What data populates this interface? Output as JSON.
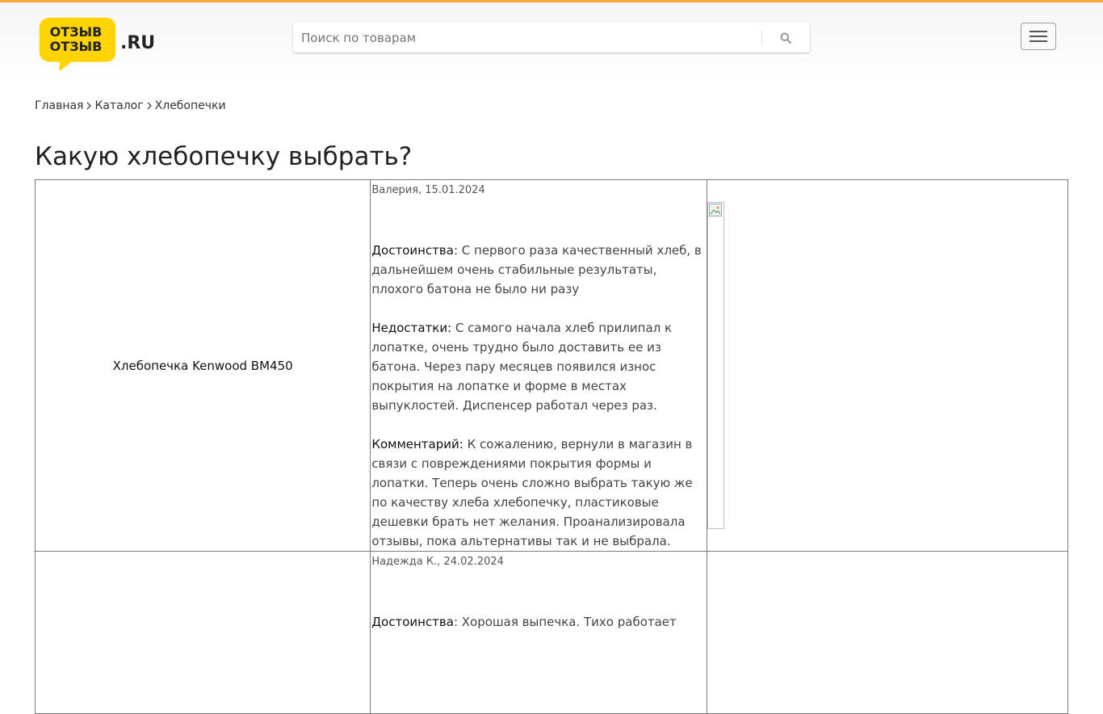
{
  "header": {
    "logo_line1": "ОТЗЫВ",
    "logo_line2": "ОТЗЫВ",
    "logo_suffix": ".RU",
    "search_placeholder": "Поиск по товарам"
  },
  "breadcrumb": [
    {
      "label": "Главная"
    },
    {
      "label": "Каталог"
    },
    {
      "label": "Хлебопечки"
    }
  ],
  "page_title": "Какую хлебопечку выбрать?",
  "reviews": [
    {
      "product": "Хлебопечка Kenwood BM450",
      "author_date": "Валерия, 15.01.2024",
      "pros_label": "Достоинства",
      "pros_text": ": С первого раза качественный хлеб, в дальнейшем очень стабильные результаты, плохого батона не было ни разу",
      "cons_label": "Недостатки:",
      "cons_text": " С самого начала хлеб прилипал к лопатке, очень трудно было доставить ее из батона. Через пару месяцев появился износ покрытия на лопатке и форме в местах выпуклостей. Диспенсер работал через раз.",
      "comment_label": "Комментарий:",
      "comment_text": " К сожалению, вернули в магазин в связи с повреждениями покрытия формы и лопатки. Теперь очень сложно выбрать такую же по качеству хлеба хлебопечку, пластиковые дешевки брать нет желания. Проанализировала отзывы, пока альтернативы так и не выбрала."
    },
    {
      "product": "",
      "author_date": "Надежда К., 24.02.2024",
      "pros_label": "Достоинства",
      "pros_text": ": Хорошая выпечка. Тихо работает"
    }
  ],
  "colors": {
    "accent_bar": "#f7a534",
    "logo_yellow": "#ffd400",
    "border": "#7a7a7a"
  },
  "icons": {
    "search": "search-icon",
    "menu": "hamburger-menu-icon",
    "breadcrumb_separator": "chevron-right-icon",
    "broken_image": "broken-image-icon"
  }
}
